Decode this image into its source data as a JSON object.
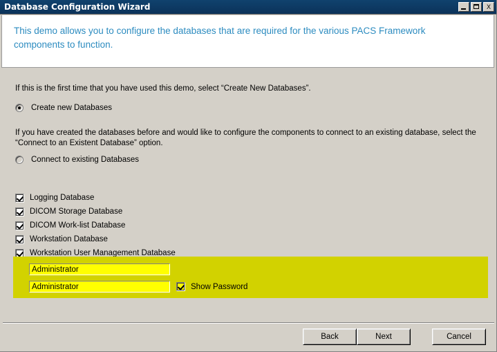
{
  "window": {
    "title": "Database Configuration Wizard",
    "controls": {
      "minimize": "_",
      "maximize": "□",
      "close": "X"
    }
  },
  "header": {
    "text": "This demo allows you to configure the databases that are required for the various PACS Framework components to function.",
    "color": "#2d8cc0"
  },
  "body": {
    "intro_paragraph": "If this is the first time that you have used this demo, select “Create New Databases”.",
    "existing_paragraph": "If you have created the databases before and would like to configure the components to connect to an existing database, select the “Connect to an Existent Database” option.",
    "radios": [
      {
        "label": "Create new Databases",
        "checked": true
      },
      {
        "label": "Connect to existing Databases",
        "checked": false
      }
    ],
    "databases": [
      {
        "label": "Logging Database",
        "checked": true
      },
      {
        "label": "DICOM Storage Database",
        "checked": true
      },
      {
        "label": "DICOM Work-list Database",
        "checked": true
      },
      {
        "label": "Workstation Database",
        "checked": true
      },
      {
        "label": "Workstation User Management Database",
        "checked": true
      }
    ],
    "credentials": {
      "highlight_color": "#d2d200",
      "field_color": "#ffff00",
      "username": "Administrator",
      "password": "Administrator",
      "username_placeholder": "",
      "password_placeholder": "",
      "show_password_label": "Show Password",
      "show_password_checked": true
    }
  },
  "footer": {
    "back_label": "Back",
    "next_label": "Next",
    "cancel_label": "Cancel"
  }
}
